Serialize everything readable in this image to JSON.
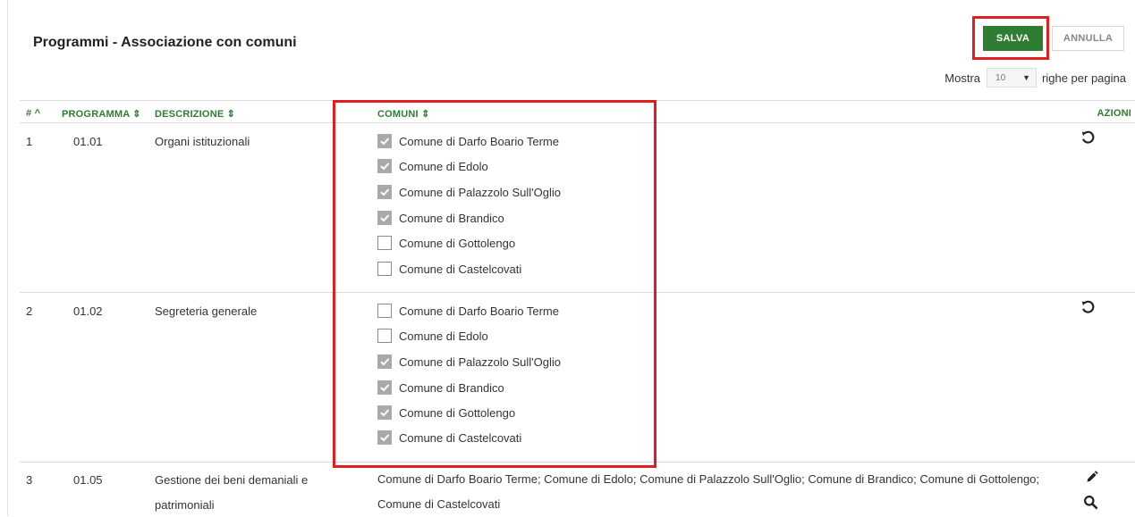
{
  "header": {
    "title": "Programmi - Associazione con comuni"
  },
  "toolbar": {
    "save_label": "SALVA",
    "cancel_label": "ANNULLA"
  },
  "pager": {
    "prefix": "Mostra",
    "value": "10",
    "suffix": "righe per pagina"
  },
  "table": {
    "columns": {
      "num": "# ^",
      "programma": "PROGRAMMA ⇕",
      "descrizione": "DESCRIZIONE ⇕",
      "comuni": "COMUNI ⇕",
      "azioni": "AZIONI"
    },
    "rows": [
      {
        "num": "1",
        "programma": "01.01",
        "descrizione": "Organi istituzionali",
        "comuni": [
          {
            "label": "Comune di Darfo Boario Terme",
            "checked": true
          },
          {
            "label": "Comune di Edolo",
            "checked": true
          },
          {
            "label": "Comune di Palazzolo Sull'Oglio",
            "checked": true
          },
          {
            "label": "Comune di Brandico",
            "checked": true
          },
          {
            "label": "Comune di Gottolengo",
            "checked": false
          },
          {
            "label": "Comune di Castelcovati",
            "checked": false
          }
        ],
        "action_icon": "undo-icon"
      },
      {
        "num": "2",
        "programma": "01.02",
        "descrizione": "Segreteria generale",
        "comuni": [
          {
            "label": "Comune di Darfo Boario Terme",
            "checked": false
          },
          {
            "label": "Comune di Edolo",
            "checked": false
          },
          {
            "label": "Comune di Palazzolo Sull'Oglio",
            "checked": true
          },
          {
            "label": "Comune di Brandico",
            "checked": true
          },
          {
            "label": "Comune di Gottolengo",
            "checked": true
          },
          {
            "label": "Comune di Castelcovati",
            "checked": true
          }
        ],
        "action_icon": "undo-icon"
      },
      {
        "num": "3",
        "programma": "01.05",
        "descrizione_line1": "Gestione dei beni demaniali e",
        "descrizione_line2": "patrimoniali",
        "comuni_text_line1": "Comune di Darfo Boario Terme; Comune di Edolo; Comune di Palazzolo Sull'Oglio; Comune di Brandico; Comune di Gottolengo;",
        "comuni_text_line2": "Comune di Castelcovati",
        "action_icons": [
          "pencil-icon",
          "search-icon"
        ]
      }
    ]
  },
  "colors": {
    "accent": "#2e7d32",
    "highlight": "#e02020",
    "checkbox_checked": "#a9a9a9"
  }
}
